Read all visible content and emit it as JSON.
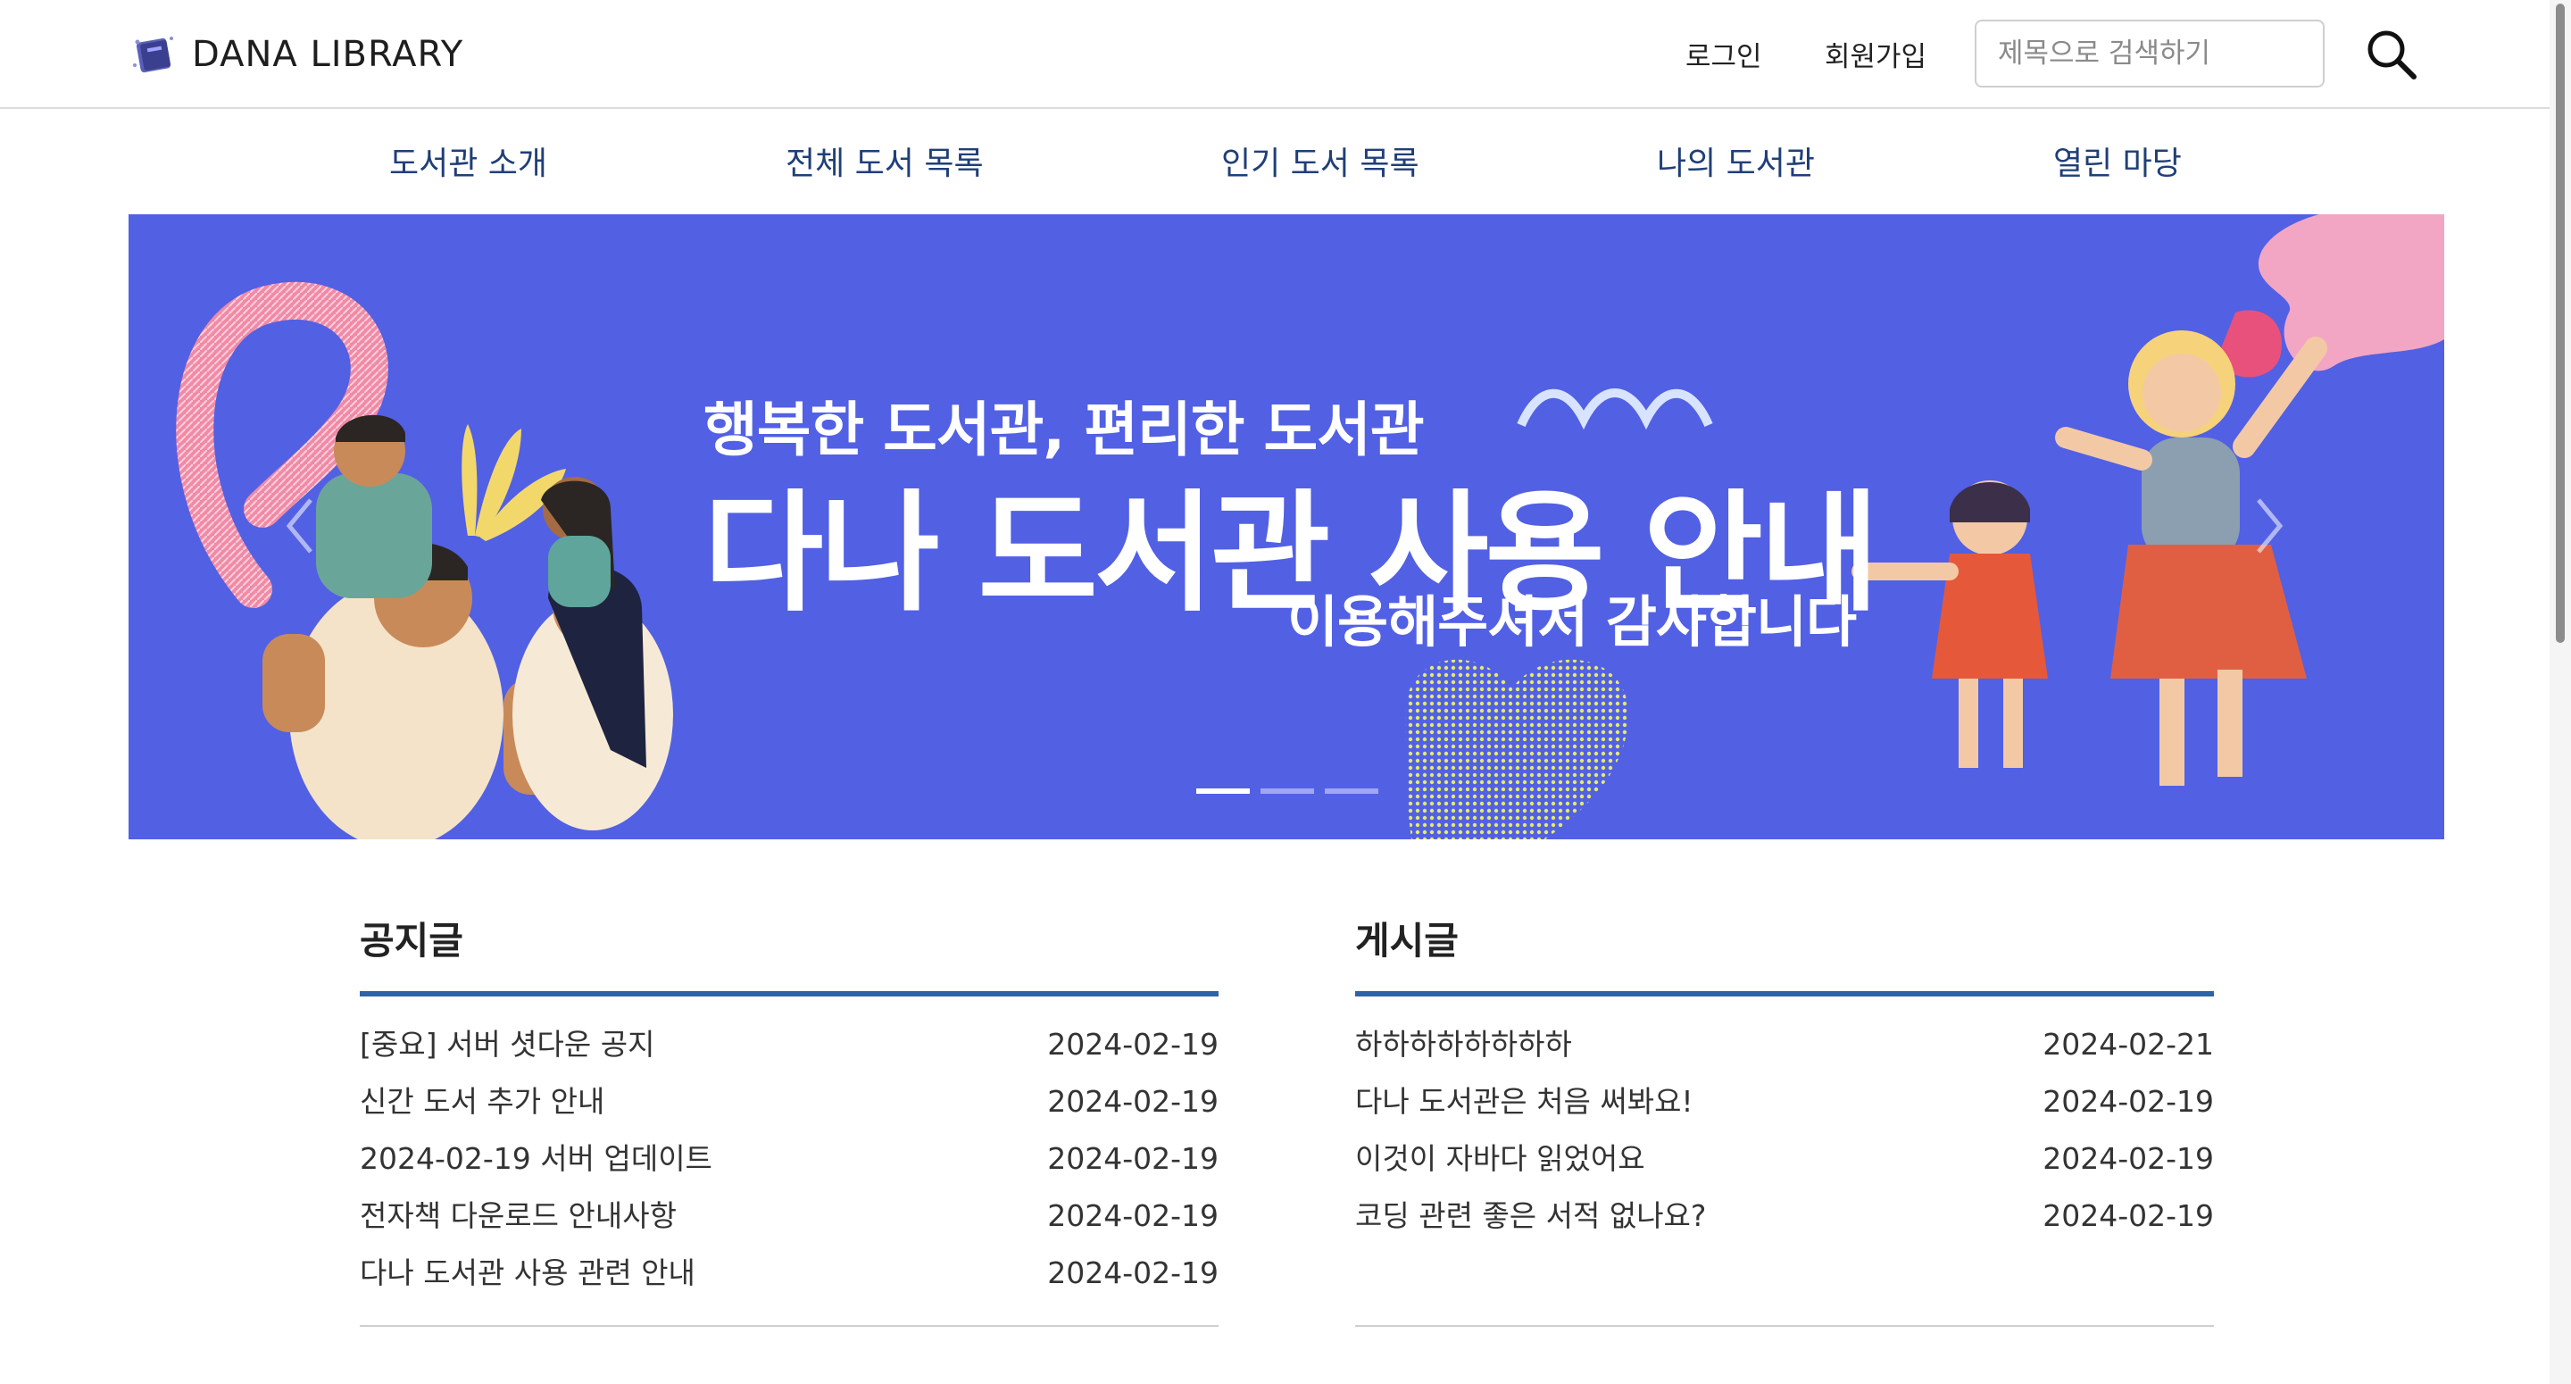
{
  "header": {
    "logo_text": "DANA LIBRARY",
    "login_label": "로그인",
    "signup_label": "회원가입",
    "search_placeholder": "제목으로 검색하기",
    "search_value": ""
  },
  "nav": {
    "items": [
      {
        "label": "도서관 소개"
      },
      {
        "label": "전체 도서 목록"
      },
      {
        "label": "인기 도서 목록"
      },
      {
        "label": "나의 도서관"
      },
      {
        "label": "열린 마당"
      }
    ]
  },
  "banner": {
    "subtitle": "행복한 도서관, 편리한 도서관",
    "title": "다나 도서관 사용 안내",
    "tagline": "이용해주셔서 감사합니다",
    "slide_count": 3,
    "active_slide": 1,
    "background_color": "#5260e4"
  },
  "notice": {
    "title": "공지글",
    "items": [
      {
        "title": "[중요] 서버 셧다운 공지",
        "date": "2024-02-19"
      },
      {
        "title": "신간 도서 추가 안내",
        "date": "2024-02-19"
      },
      {
        "title": "2024-02-19 서버 업데이트",
        "date": "2024-02-19"
      },
      {
        "title": "전자책 다운로드 안내사항",
        "date": "2024-02-19"
      },
      {
        "title": "다나 도서관 사용 관련 안내",
        "date": "2024-02-19"
      }
    ]
  },
  "posts": {
    "title": "게시글",
    "items": [
      {
        "title": "하하하하하하하하",
        "date": "2024-02-21"
      },
      {
        "title": "다나 도서관은 처음 써봐요!",
        "date": "2024-02-19"
      },
      {
        "title": "이것이 자바다 읽었어요",
        "date": "2024-02-19"
      },
      {
        "title": "코딩 관련 좋은 서적 없나요?",
        "date": "2024-02-19"
      }
    ]
  },
  "colors": {
    "nav_text": "#1f3f78",
    "board_accent": "#2e63a8",
    "banner_bg": "#5260e4"
  },
  "icons": [
    "book-logo-icon",
    "search-icon",
    "chevron-left-icon",
    "chevron-right-icon"
  ]
}
